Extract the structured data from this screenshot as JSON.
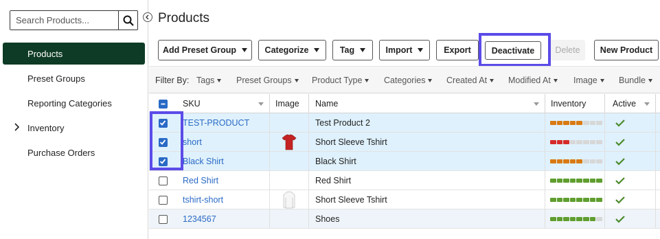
{
  "sidebar": {
    "search_placeholder": "Search Products...",
    "items": [
      {
        "label": "Products",
        "active": true
      },
      {
        "label": "Preset Groups"
      },
      {
        "label": "Reporting Categories"
      },
      {
        "label": "Inventory",
        "expandable": true
      },
      {
        "label": "Purchase Orders"
      }
    ]
  },
  "page": {
    "title": "Products"
  },
  "toolbar": {
    "add_preset_group": "Add Preset Group",
    "categorize": "Categorize",
    "tag": "Tag",
    "import": "Import",
    "export": "Export",
    "deactivate": "Deactivate",
    "delete": "Delete",
    "new_product": "New Product"
  },
  "filters": {
    "label": "Filter By:",
    "items": [
      "Tags",
      "Preset Groups",
      "Product Type",
      "Categories",
      "Created At",
      "Modified At",
      "Image",
      "Bundle"
    ]
  },
  "columns": {
    "sku": "SKU",
    "image": "Image",
    "name": "Name",
    "inventory": "Inventory",
    "active": "Active"
  },
  "rows": [
    {
      "sku": "TEST-PRODUCT",
      "name": "Test Product 2",
      "selected": true,
      "image": "",
      "inventory": [
        "o",
        "o",
        "o",
        "o",
        "o",
        "g",
        "g",
        "g"
      ],
      "active": true
    },
    {
      "sku": "short",
      "name": "Short Sleeve Tshirt",
      "selected": true,
      "image": "red-tshirt",
      "inventory": [
        "r",
        "r",
        "r",
        "g",
        "g",
        "g",
        "g",
        "g"
      ],
      "active": true
    },
    {
      "sku": "Black Shirt",
      "name": "Black Shirt",
      "selected": true,
      "image": "",
      "inventory": [
        "o",
        "o",
        "o",
        "o",
        "o",
        "g",
        "g",
        "g"
      ],
      "active": true
    },
    {
      "sku": "Red Shirt",
      "name": "Red Shirt",
      "selected": false,
      "image": "",
      "inventory": [
        "G",
        "G",
        "G",
        "G",
        "G",
        "G",
        "G",
        "G"
      ],
      "active": true
    },
    {
      "sku": "tshirt-short",
      "name": "Short Sleeve Tshirt",
      "selected": false,
      "image": "white-shirt",
      "inventory": [
        "G",
        "G",
        "G",
        "G",
        "G",
        "G",
        "G",
        "G"
      ],
      "active": true
    },
    {
      "sku": "1234567",
      "name": "Shoes",
      "selected": false,
      "image": "",
      "inventory": [
        "G",
        "G",
        "G",
        "G",
        "G",
        "G",
        "G",
        "g"
      ],
      "active": true
    }
  ],
  "colors": {
    "accent": "#0e3b25",
    "link": "#2a6ac6",
    "highlight": "#5b4be8",
    "orange": "#d97a12",
    "red": "#d62a2a",
    "green": "#5f9e2f",
    "empty": "#d7d7d7"
  }
}
